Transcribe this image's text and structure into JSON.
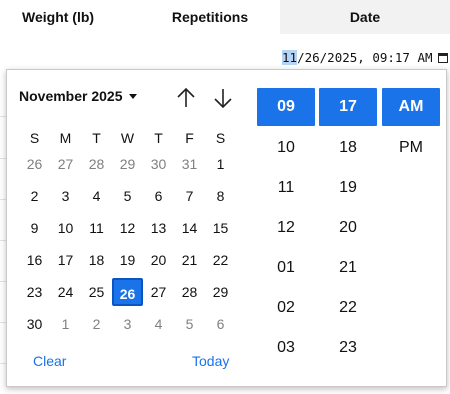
{
  "table": {
    "headers": [
      "Weight (lb)",
      "Repetitions",
      "Date"
    ]
  },
  "date_input": {
    "month": "11",
    "rest": "/26/2025, 09:17 AM"
  },
  "calendar": {
    "month_label": "November 2025",
    "weekdays": [
      "S",
      "M",
      "T",
      "W",
      "T",
      "F",
      "S"
    ],
    "weeks": [
      [
        {
          "d": "26",
          "o": true
        },
        {
          "d": "27",
          "o": true
        },
        {
          "d": "28",
          "o": true
        },
        {
          "d": "29",
          "o": true
        },
        {
          "d": "30",
          "o": true
        },
        {
          "d": "31",
          "o": true
        },
        {
          "d": "1",
          "o": false
        }
      ],
      [
        {
          "d": "2",
          "o": false
        },
        {
          "d": "3",
          "o": false
        },
        {
          "d": "4",
          "o": false
        },
        {
          "d": "5",
          "o": false
        },
        {
          "d": "6",
          "o": false
        },
        {
          "d": "7",
          "o": false
        },
        {
          "d": "8",
          "o": false
        }
      ],
      [
        {
          "d": "9",
          "o": false
        },
        {
          "d": "10",
          "o": false
        },
        {
          "d": "11",
          "o": false
        },
        {
          "d": "12",
          "o": false
        },
        {
          "d": "13",
          "o": false
        },
        {
          "d": "14",
          "o": false
        },
        {
          "d": "15",
          "o": false
        }
      ],
      [
        {
          "d": "16",
          "o": false
        },
        {
          "d": "17",
          "o": false
        },
        {
          "d": "18",
          "o": false
        },
        {
          "d": "19",
          "o": false
        },
        {
          "d": "20",
          "o": false
        },
        {
          "d": "21",
          "o": false
        },
        {
          "d": "22",
          "o": false
        }
      ],
      [
        {
          "d": "23",
          "o": false
        },
        {
          "d": "24",
          "o": false
        },
        {
          "d": "25",
          "o": false
        },
        {
          "d": "26",
          "o": false,
          "sel": true
        },
        {
          "d": "27",
          "o": false
        },
        {
          "d": "28",
          "o": false
        },
        {
          "d": "29",
          "o": false
        }
      ],
      [
        {
          "d": "30",
          "o": false
        },
        {
          "d": "1",
          "o": true
        },
        {
          "d": "2",
          "o": true
        },
        {
          "d": "3",
          "o": true
        },
        {
          "d": "4",
          "o": true
        },
        {
          "d": "5",
          "o": true
        },
        {
          "d": "6",
          "o": true
        }
      ]
    ],
    "clear_label": "Clear",
    "today_label": "Today"
  },
  "time": {
    "hours": [
      "09",
      "10",
      "11",
      "12",
      "01",
      "02",
      "03"
    ],
    "minutes": [
      "17",
      "18",
      "19",
      "20",
      "21",
      "22",
      "23"
    ],
    "ampm": [
      "AM",
      "PM"
    ],
    "selected_hour": "09",
    "selected_minute": "17",
    "selected_ampm": "AM"
  },
  "colors": {
    "accent": "#1a73e8",
    "header_date_bg": "#f2f2f2",
    "input_highlight": "#b6d4f6"
  }
}
